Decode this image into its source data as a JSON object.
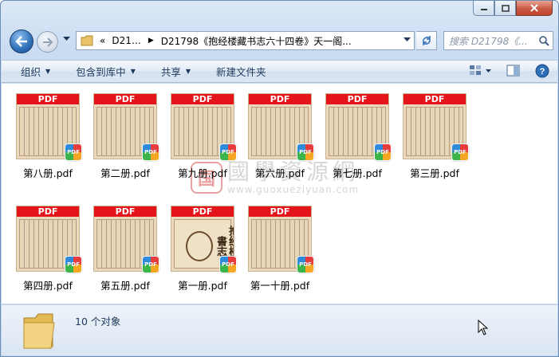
{
  "window": {
    "breadcrumb": [
      "«",
      "D21…",
      "D21798《抱经楼藏书志六十四卷》天一阁..."
    ],
    "search_placeholder": "搜索 D21798《..."
  },
  "toolbar": {
    "organize": "组织",
    "include_library": "包含到库中",
    "share": "共享",
    "new_folder": "新建文件夹"
  },
  "files": [
    {
      "name": "第八册.pdf",
      "badge": "PDF"
    },
    {
      "name": "第二册.pdf",
      "badge": "PDF"
    },
    {
      "name": "第九册.pdf",
      "badge": "PDF"
    },
    {
      "name": "第六册.pdf",
      "badge": "PDF"
    },
    {
      "name": "第七册.pdf",
      "badge": "PDF"
    },
    {
      "name": "第三册.pdf",
      "badge": "PDF"
    },
    {
      "name": "第四册.pdf",
      "badge": "PDF"
    },
    {
      "name": "第五册.pdf",
      "badge": "PDF"
    },
    {
      "name": "第一册.pdf",
      "badge": "PDF"
    },
    {
      "name": "第一十册.pdf",
      "badge": "PDF"
    }
  ],
  "cover_title": "抱经楼藏書志",
  "watermark": {
    "logo": "国",
    "title": "國學資源網",
    "url": "www.guoxueziyuan.com"
  },
  "status": {
    "count": "10 个对象"
  },
  "colors": {
    "pdf_band": "#e4141b",
    "accent": "#1e395b"
  }
}
